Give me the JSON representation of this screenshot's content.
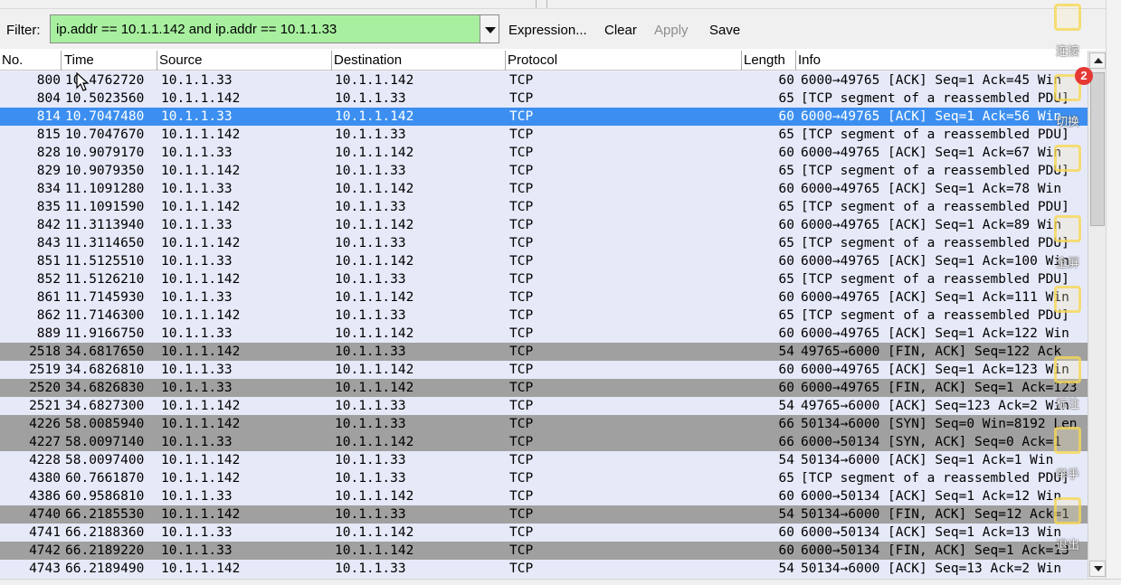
{
  "filter": {
    "label": "Filter:",
    "value": "ip.addr == 10.1.1.142 and ip.addr == 10.1.1.33",
    "valid_color": "#a8f0a0",
    "buttons": {
      "expression": "Expression...",
      "clear": "Clear",
      "apply": "Apply",
      "save": "Save"
    }
  },
  "columns": {
    "no": "No.",
    "time": "Time",
    "source": "Source",
    "destination": "Destination",
    "protocol": "Protocol",
    "length": "Length",
    "info": "Info"
  },
  "colors": {
    "row_normal": "#e6e9f8",
    "row_fin_syn": "#a0a0a0",
    "row_selected": "#3c8ff0"
  },
  "packets": [
    {
      "no": "800",
      "time": "10.4762720",
      "src": "10.1.1.33",
      "dst": "10.1.1.142",
      "proto": "TCP",
      "len": "60",
      "info": "6000→49765 [ACK] Seq=1 Ack=45 Win",
      "style": "normal"
    },
    {
      "no": "804",
      "time": "10.5023560",
      "src": "10.1.1.142",
      "dst": "10.1.1.33",
      "proto": "TCP",
      "len": "65",
      "info": "[TCP segment of a reassembled PDU]",
      "style": "normal"
    },
    {
      "no": "814",
      "time": "10.7047480",
      "src": "10.1.1.33",
      "dst": "10.1.1.142",
      "proto": "TCP",
      "len": "60",
      "info": "6000→49765 [ACK] Seq=1 Ack=56 Win",
      "style": "selected"
    },
    {
      "no": "815",
      "time": "10.7047670",
      "src": "10.1.1.142",
      "dst": "10.1.1.33",
      "proto": "TCP",
      "len": "65",
      "info": "[TCP segment of a reassembled PDU]",
      "style": "normal"
    },
    {
      "no": "828",
      "time": "10.9079170",
      "src": "10.1.1.33",
      "dst": "10.1.1.142",
      "proto": "TCP",
      "len": "60",
      "info": "6000→49765 [ACK] Seq=1 Ack=67 Win",
      "style": "normal"
    },
    {
      "no": "829",
      "time": "10.9079350",
      "src": "10.1.1.142",
      "dst": "10.1.1.33",
      "proto": "TCP",
      "len": "65",
      "info": "[TCP segment of a reassembled PDU]",
      "style": "normal"
    },
    {
      "no": "834",
      "time": "11.1091280",
      "src": "10.1.1.33",
      "dst": "10.1.1.142",
      "proto": "TCP",
      "len": "60",
      "info": "6000→49765 [ACK] Seq=1 Ack=78 Win",
      "style": "normal"
    },
    {
      "no": "835",
      "time": "11.1091590",
      "src": "10.1.1.142",
      "dst": "10.1.1.33",
      "proto": "TCP",
      "len": "65",
      "info": "[TCP segment of a reassembled PDU]",
      "style": "normal"
    },
    {
      "no": "842",
      "time": "11.3113940",
      "src": "10.1.1.33",
      "dst": "10.1.1.142",
      "proto": "TCP",
      "len": "60",
      "info": "6000→49765 [ACK] Seq=1 Ack=89 Win",
      "style": "normal"
    },
    {
      "no": "843",
      "time": "11.3114650",
      "src": "10.1.1.142",
      "dst": "10.1.1.33",
      "proto": "TCP",
      "len": "65",
      "info": "[TCP segment of a reassembled PDU]",
      "style": "normal"
    },
    {
      "no": "851",
      "time": "11.5125510",
      "src": "10.1.1.33",
      "dst": "10.1.1.142",
      "proto": "TCP",
      "len": "60",
      "info": "6000→49765 [ACK] Seq=1 Ack=100 Win",
      "style": "normal"
    },
    {
      "no": "852",
      "time": "11.5126210",
      "src": "10.1.1.142",
      "dst": "10.1.1.33",
      "proto": "TCP",
      "len": "65",
      "info": "[TCP segment of a reassembled PDU]",
      "style": "normal"
    },
    {
      "no": "861",
      "time": "11.7145930",
      "src": "10.1.1.33",
      "dst": "10.1.1.142",
      "proto": "TCP",
      "len": "60",
      "info": "6000→49765 [ACK] Seq=1 Ack=111 Win",
      "style": "normal"
    },
    {
      "no": "862",
      "time": "11.7146300",
      "src": "10.1.1.142",
      "dst": "10.1.1.33",
      "proto": "TCP",
      "len": "65",
      "info": "[TCP segment of a reassembled PDU]",
      "style": "normal"
    },
    {
      "no": "889",
      "time": "11.9166750",
      "src": "10.1.1.33",
      "dst": "10.1.1.142",
      "proto": "TCP",
      "len": "60",
      "info": "6000→49765 [ACK] Seq=1 Ack=122 Win",
      "style": "normal"
    },
    {
      "no": "2518",
      "time": "34.6817650",
      "src": "10.1.1.142",
      "dst": "10.1.1.33",
      "proto": "TCP",
      "len": "54",
      "info": "49765→6000 [FIN, ACK] Seq=122 Ack",
      "style": "fin"
    },
    {
      "no": "2519",
      "time": "34.6826810",
      "src": "10.1.1.33",
      "dst": "10.1.1.142",
      "proto": "TCP",
      "len": "60",
      "info": "6000→49765 [ACK] Seq=1 Ack=123 Win",
      "style": "normal"
    },
    {
      "no": "2520",
      "time": "34.6826830",
      "src": "10.1.1.33",
      "dst": "10.1.1.142",
      "proto": "TCP",
      "len": "60",
      "info": "6000→49765 [FIN, ACK] Seq=1 Ack=123",
      "style": "fin"
    },
    {
      "no": "2521",
      "time": "34.6827300",
      "src": "10.1.1.142",
      "dst": "10.1.1.33",
      "proto": "TCP",
      "len": "54",
      "info": "49765→6000 [ACK] Seq=123 Ack=2 Win",
      "style": "normal"
    },
    {
      "no": "4226",
      "time": "58.0085940",
      "src": "10.1.1.142",
      "dst": "10.1.1.33",
      "proto": "TCP",
      "len": "66",
      "info": "50134→6000 [SYN] Seq=0 Win=8192 Len",
      "style": "fin"
    },
    {
      "no": "4227",
      "time": "58.0097140",
      "src": "10.1.1.33",
      "dst": "10.1.1.142",
      "proto": "TCP",
      "len": "66",
      "info": "6000→50134 [SYN, ACK] Seq=0 Ack=1",
      "style": "fin"
    },
    {
      "no": "4228",
      "time": "58.0097400",
      "src": "10.1.1.142",
      "dst": "10.1.1.33",
      "proto": "TCP",
      "len": "54",
      "info": "50134→6000 [ACK] Seq=1 Ack=1 Win",
      "style": "normal"
    },
    {
      "no": "4380",
      "time": "60.7661870",
      "src": "10.1.1.142",
      "dst": "10.1.1.33",
      "proto": "TCP",
      "len": "65",
      "info": "[TCP segment of a reassembled PDU]",
      "style": "normal"
    },
    {
      "no": "4386",
      "time": "60.9586810",
      "src": "10.1.1.33",
      "dst": "10.1.1.142",
      "proto": "TCP",
      "len": "60",
      "info": "6000→50134 [ACK] Seq=1 Ack=12 Win",
      "style": "normal"
    },
    {
      "no": "4740",
      "time": "66.2185530",
      "src": "10.1.1.142",
      "dst": "10.1.1.33",
      "proto": "TCP",
      "len": "54",
      "info": "50134→6000 [FIN, ACK] Seq=12 Ack=1",
      "style": "fin"
    },
    {
      "no": "4741",
      "time": "66.2188360",
      "src": "10.1.1.33",
      "dst": "10.1.1.142",
      "proto": "TCP",
      "len": "60",
      "info": "6000→50134 [ACK] Seq=1 Ack=13 Win",
      "style": "normal"
    },
    {
      "no": "4742",
      "time": "66.2189220",
      "src": "10.1.1.33",
      "dst": "10.1.1.142",
      "proto": "TCP",
      "len": "60",
      "info": "6000→50134 [FIN, ACK] Seq=1 Ack=13",
      "style": "fin"
    },
    {
      "no": "4743",
      "time": "66.2189490",
      "src": "10.1.1.142",
      "dst": "10.1.1.33",
      "proto": "TCP",
      "len": "54",
      "info": "50134→6000 [ACK] Seq=13 Ack=2 Win",
      "style": "normal"
    }
  ],
  "overlay_toolbar": [
    {
      "label": "连接",
      "icon": "connect-icon"
    },
    {
      "label": "切换",
      "icon": "switch-icon",
      "badge": "2"
    },
    {
      "label": "",
      "icon": "pen-icon"
    },
    {
      "label": "全屏",
      "icon": "fullscreen-icon"
    },
    {
      "label": "",
      "icon": "grid-icon"
    },
    {
      "label": "标注",
      "icon": "annotate-icon"
    },
    {
      "label": "举手",
      "icon": "raise-hand-icon"
    },
    {
      "label": "退出",
      "icon": "exit-icon"
    }
  ]
}
